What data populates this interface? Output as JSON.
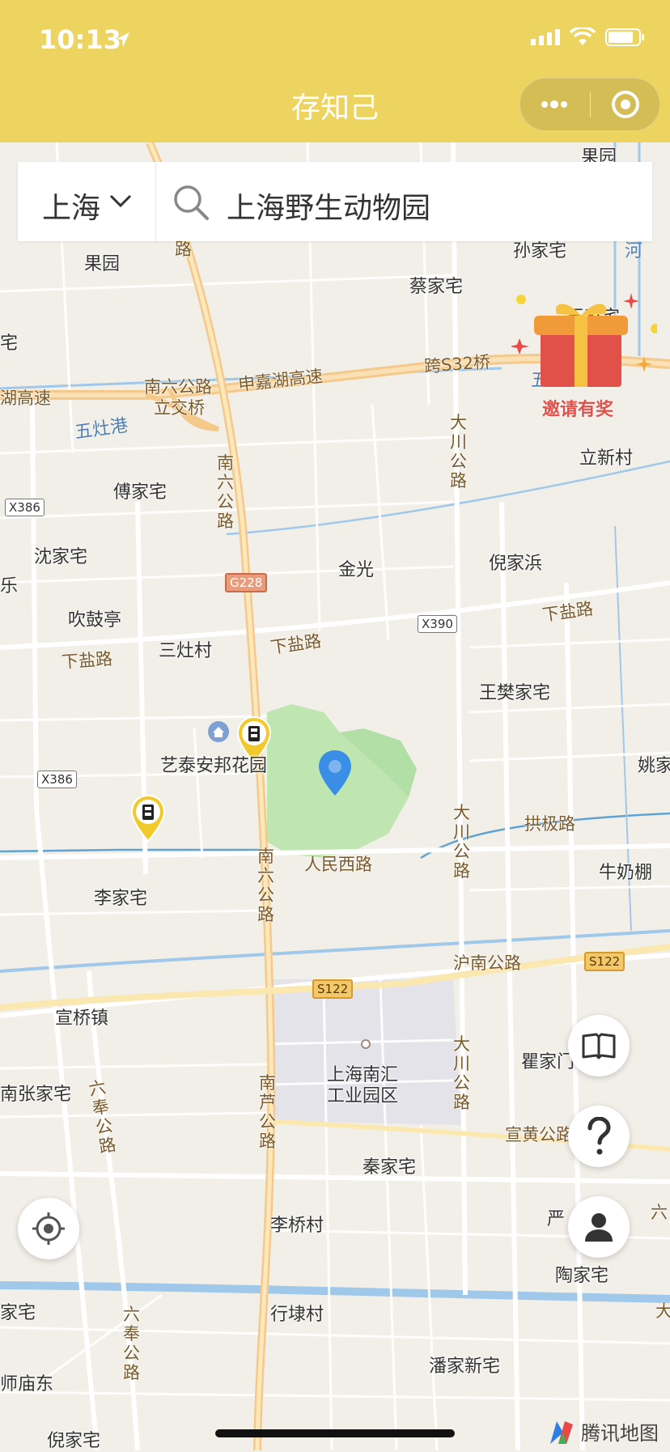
{
  "status_bar": {
    "time": "10:13"
  },
  "header": {
    "title": "存知己"
  },
  "search": {
    "city": "上海",
    "query": "上海野生动物园"
  },
  "promo": {
    "label": "邀请有奖"
  },
  "map": {
    "places": [
      "果园",
      "果园",
      "蔡家宅",
      "孙家宅",
      "王家宅",
      "立新村",
      "傅家宅",
      "沈家宅",
      "金光",
      "倪家浜",
      "吹鼓亭",
      "三灶村",
      "王樊家宅",
      "姚家",
      "艺泰安邦花园",
      "李家宅",
      "牛奶棚",
      "宣桥镇",
      "瞿家门",
      "上海南汇",
      "工业园区",
      "南张家宅",
      "秦家宅",
      "李桥村",
      "严",
      "陶家宅",
      "家宅",
      "行埭村",
      "师庙东",
      "潘家新宅",
      "倪家宅",
      "宅",
      "乐"
    ],
    "roads": [
      "南六公路",
      "立交桥",
      "申嘉湖高速",
      "跨S32桥",
      "湖高速",
      "南六公路",
      "大川公路",
      "下盐路",
      "下盐路",
      "下盐路",
      "拱极路",
      "人民西路",
      "南六公路",
      "大川公路",
      "沪南公路",
      "大川公路",
      "南芦公路",
      "六奉公路",
      "宣黄公路",
      "六奉公路",
      "路",
      "六",
      "大"
    ],
    "waters": [
      "五灶港",
      "五",
      "河"
    ],
    "shields": [
      "X386",
      "G228",
      "X390",
      "X386",
      "S122",
      "S122"
    ]
  },
  "attribution": "腾讯地图",
  "colors": {
    "header": "#edd35f",
    "marker": "#3a8ee6",
    "park": "#bfe6b0",
    "highway": "#f4c98a",
    "water": "#7ab6e0"
  },
  "buttons": [
    "book-icon",
    "help-icon",
    "user-icon",
    "locate-icon"
  ]
}
